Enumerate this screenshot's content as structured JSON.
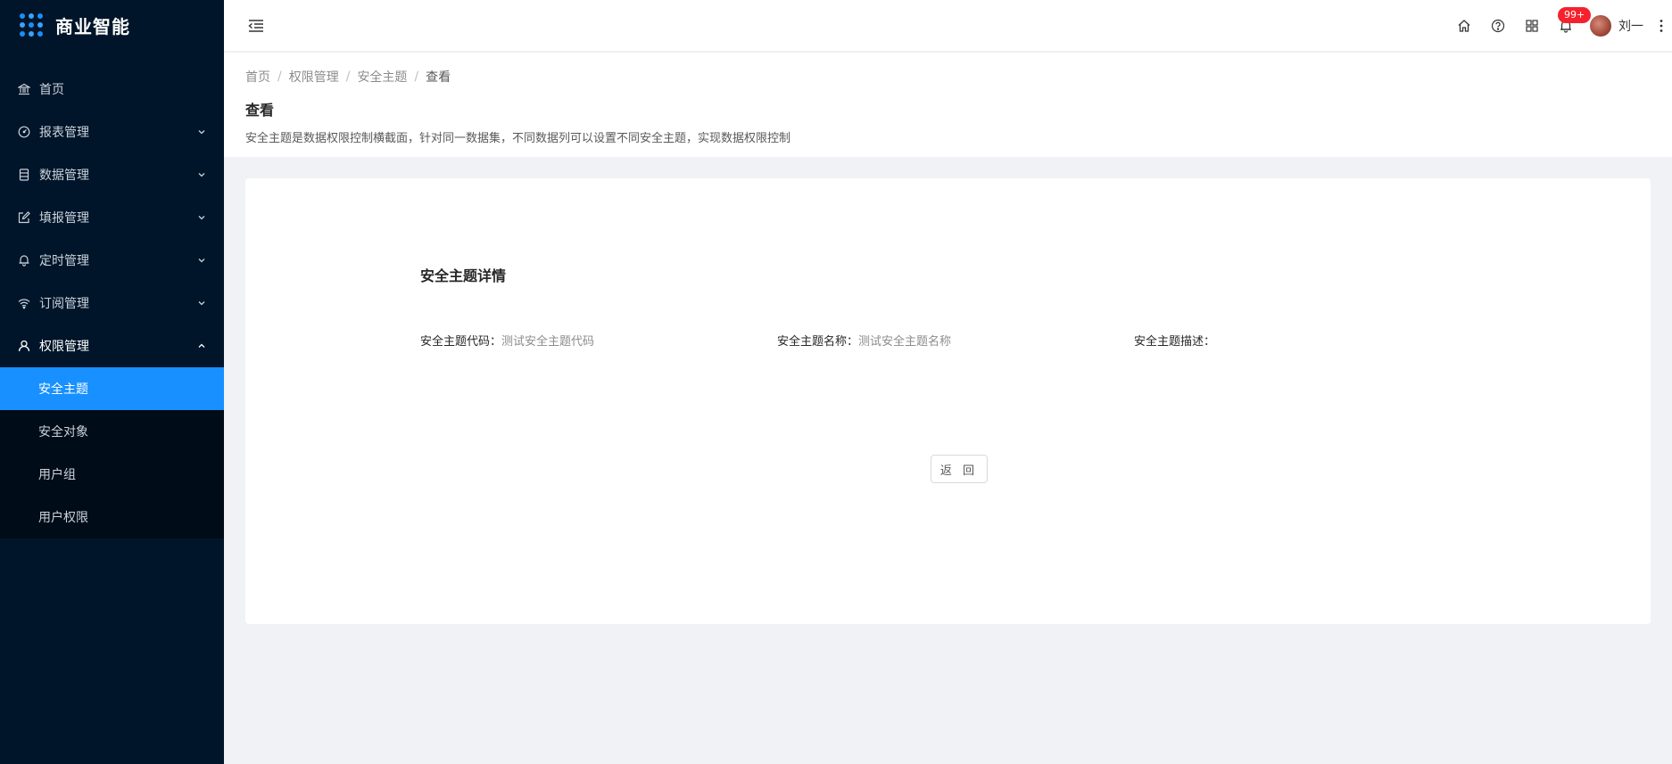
{
  "app": {
    "title": "商业智能"
  },
  "sidebar": {
    "items": [
      {
        "label": "首页",
        "icon": "bank-icon"
      },
      {
        "label": "报表管理",
        "icon": "dashboard-icon"
      },
      {
        "label": "数据管理",
        "icon": "database-icon"
      },
      {
        "label": "填报管理",
        "icon": "edit-icon"
      },
      {
        "label": "定时管理",
        "icon": "bell-icon"
      },
      {
        "label": "订阅管理",
        "icon": "wifi-icon"
      },
      {
        "label": "权限管理",
        "icon": "user-icon"
      }
    ],
    "submenu": [
      {
        "label": "安全主题",
        "active": true
      },
      {
        "label": "安全对象",
        "active": false
      },
      {
        "label": "用户组",
        "active": false
      },
      {
        "label": "用户权限",
        "active": false
      }
    ]
  },
  "header": {
    "badge": "99+",
    "user_name": "刘一"
  },
  "breadcrumb": [
    "首页",
    "权限管理",
    "安全主题",
    "查看"
  ],
  "breadcrumb_sep": "/",
  "page": {
    "title": "查看",
    "description": "安全主题是数据权限控制横截面，针对同一数据集，不同数据列可以设置不同安全主题，实现数据权限控制"
  },
  "detail": {
    "title": "安全主题详情",
    "fields": [
      {
        "label": "安全主题代码：",
        "value": "测试安全主题代码"
      },
      {
        "label": "安全主题名称：",
        "value": "测试安全主题名称"
      },
      {
        "label": "安全主题描述：",
        "value": ""
      }
    ],
    "back_label": "返 回"
  },
  "colors": {
    "sidebar_bg": "#001529",
    "accent": "#1890ff",
    "badge": "#f5222d",
    "page_bg": "#f0f2f5"
  }
}
